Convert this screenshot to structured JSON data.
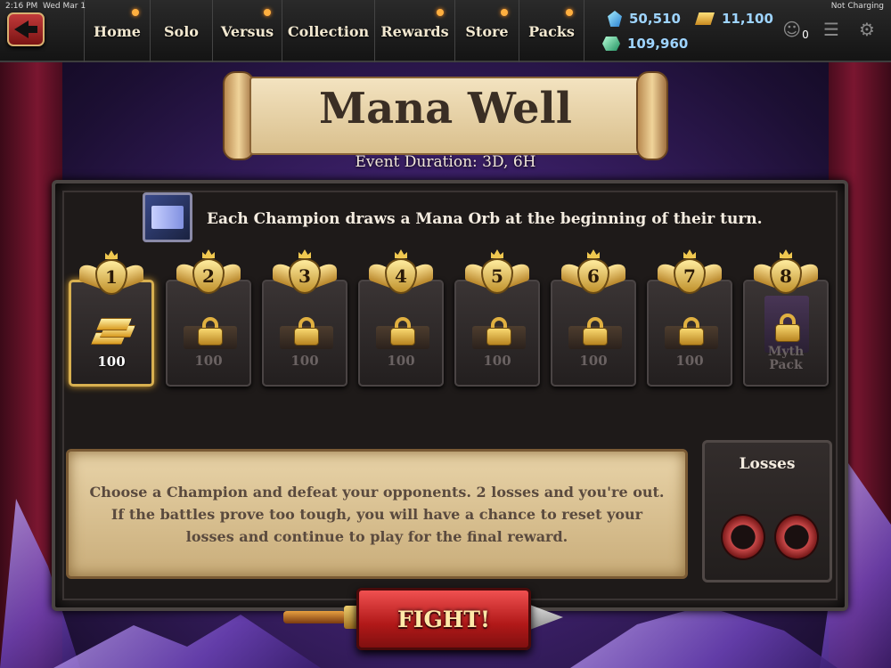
{
  "status_bar": {
    "time": "2:16 PM",
    "date": "Wed Mar 1",
    "battery": "Not Charging"
  },
  "nav": {
    "back_icon": "back-arrow-icon",
    "tabs": [
      {
        "label": "Home"
      },
      {
        "label": "Solo"
      },
      {
        "label": "Versus"
      },
      {
        "label": "Collection"
      },
      {
        "label": "Rewards"
      },
      {
        "label": "Store"
      },
      {
        "label": "Packs"
      }
    ]
  },
  "currencies": {
    "blue_gems": "50,510",
    "green_gems": "109,960",
    "gold": "11,100",
    "friends_count": "0"
  },
  "event": {
    "title": "Mana Well",
    "duration": "Event Duration: 3D, 6H",
    "rule": "Each Champion draws a Mana Orb at the beginning of their turn.",
    "description": "Choose a Champion and defeat your opponents. 2 losses and you're out. If the battles prove too tough, you will have a chance to reset your losses and continue to play for the final reward."
  },
  "rewards": [
    {
      "rank": "1",
      "amount": "100",
      "locked": false
    },
    {
      "rank": "2",
      "amount": "100",
      "locked": true
    },
    {
      "rank": "3",
      "amount": "100",
      "locked": true
    },
    {
      "rank": "4",
      "amount": "100",
      "locked": true
    },
    {
      "rank": "5",
      "amount": "100",
      "locked": true
    },
    {
      "rank": "6",
      "amount": "100",
      "locked": true
    },
    {
      "rank": "7",
      "amount": "100",
      "locked": true
    },
    {
      "rank": "8",
      "amount": "Myth Pack",
      "locked": true
    }
  ],
  "losses": {
    "title": "Losses",
    "slots": 2
  },
  "fight_label": "FIGHT!",
  "colors": {
    "accent_gold": "#d8b050",
    "fight_red": "#d02828",
    "gem_blue": "#9ed4ff"
  }
}
